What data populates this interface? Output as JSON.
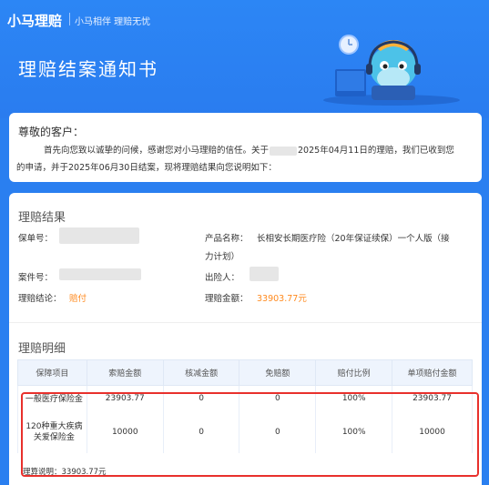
{
  "header": {
    "brand": "小马理赔",
    "slogan": "小马相伴 理赔无忧",
    "title": "理赔结案通知书"
  },
  "letter": {
    "greeting": "尊敬的客户：",
    "intro_line1_prefix": "首先向您致以诚挚的问候，感谢您对小马理赔的信任。关于",
    "intro_line1_suffix": "2025年04月11日的理赔，我们已收到您",
    "intro_line2": "的申请，并于2025年06月30日结案，现将理赔结果向您说明如下："
  },
  "result": {
    "section_title": "理赔结果",
    "policy_no_label": "保单号：",
    "product_label": "产品名称：",
    "product_value_line1": "长相安长期医疗险（20年保证续保）一个人版（接",
    "product_value_line2": "力计划）",
    "case_no_label": "案件号：",
    "insured_label": "出险人：",
    "conclusion_label": "理赔结论：",
    "conclusion_value": "赔付",
    "amount_label": "理赔金额：",
    "amount_value": "33903.77元"
  },
  "detail": {
    "section_title": "理赔明细",
    "columns": [
      "保障项目",
      "索赔金额",
      "核减金额",
      "免赔额",
      "赔付比例",
      "单项赔付金额"
    ],
    "rows": [
      [
        "一般医疗保险金",
        "23903.77",
        "0",
        "0",
        "100%",
        "23903.77"
      ],
      [
        "120种重大疾病关爱保险金",
        "10000",
        "0",
        "0",
        "100%",
        "10000"
      ]
    ],
    "note": "理算说明：33903.77元"
  },
  "colors": {
    "primary": "#2a7ff0",
    "accent_orange": "#ff8a1f",
    "highlight_red": "#e8302c"
  }
}
